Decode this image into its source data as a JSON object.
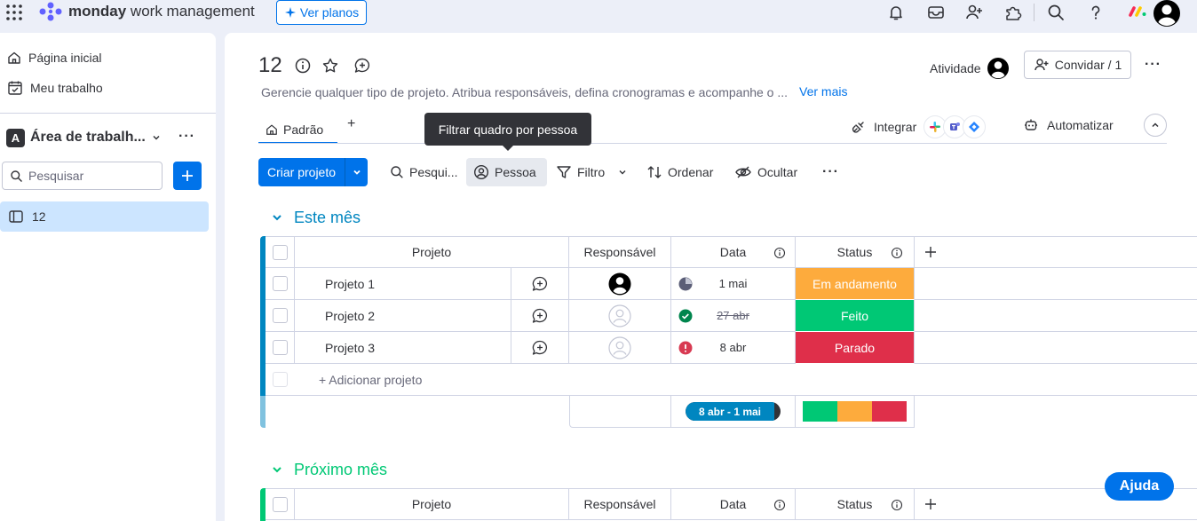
{
  "topbar": {
    "brand_bold": "monday",
    "brand_light": "work management",
    "ver_planos": "Ver planos"
  },
  "sidebar": {
    "items": [
      {
        "label": "Página inicial",
        "icon": "home-icon"
      },
      {
        "label": "Meu trabalho",
        "icon": "calendar-check-icon"
      }
    ],
    "workspace": {
      "badge": "A",
      "name": "Área de trabalh..."
    },
    "search_placeholder": "Pesquisar",
    "boards": [
      {
        "label": "12",
        "icon": "board-icon"
      }
    ]
  },
  "board": {
    "title": "12",
    "description": "Gerencie qualquer tipo de projeto. Atribua responsáveis, defina cronogramas e acompanhe o ...",
    "ver_mais": "Ver mais",
    "atividade": "Atividade",
    "convidar": "Convidar / 1",
    "tabs": [
      {
        "label": "Padrão"
      },
      {
        "label": "+"
      }
    ],
    "integrar": "Integrar",
    "automatizar": "Automatizar",
    "tooltip": "Filtrar quadro por pessoa"
  },
  "toolbar": {
    "criar": "Criar projeto",
    "pesquisar": "Pesqui...",
    "pessoa": "Pessoa",
    "filtro": "Filtro",
    "ordenar": "Ordenar",
    "ocultar": "Ocultar"
  },
  "colors": {
    "accent": "#0073ea",
    "group1": "#0086c0",
    "group2": "#00c875",
    "working": "#fdab3d",
    "done": "#00c875",
    "stuck": "#df2f4a"
  },
  "groups": [
    {
      "title": "Este mês",
      "columns": [
        "Projeto",
        "Responsável",
        "Data",
        "Status"
      ],
      "rows": [
        {
          "name": "Projeto 1",
          "date": "1 mai",
          "status": "Em andamento",
          "date_icon": "clock-pie-icon",
          "owner": "filled"
        },
        {
          "name": "Projeto 2",
          "date": "27 abr",
          "status": "Feito",
          "date_icon": "check-circle-icon",
          "owner": "empty"
        },
        {
          "name": "Projeto 3",
          "date": "8 abr",
          "status": "Parado",
          "date_icon": "alert-icon",
          "owner": "empty"
        }
      ],
      "add_label": "+ Adicionar projeto",
      "summary_date": "8 abr - 1 mai"
    },
    {
      "title": "Próximo mês",
      "columns": [
        "Projeto",
        "Responsável",
        "Data",
        "Status"
      ]
    }
  ],
  "help": "Ajuda"
}
